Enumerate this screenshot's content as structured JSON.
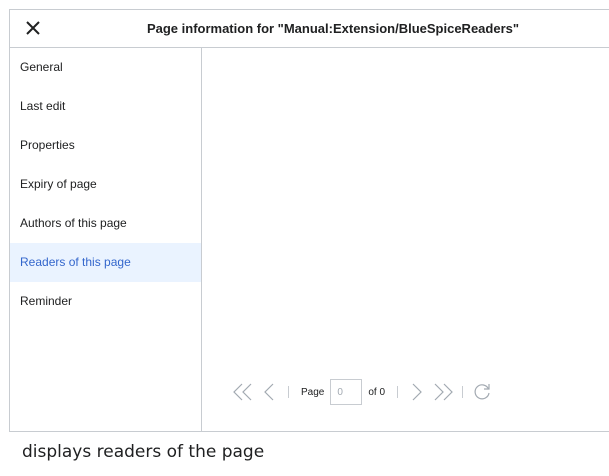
{
  "dialog": {
    "title": "Page information for \"Manual:Extension/BlueSpiceReaders\"",
    "close_icon": "close-icon"
  },
  "sidebar": {
    "items": [
      {
        "label": "General",
        "active": false
      },
      {
        "label": "Last edit",
        "active": false
      },
      {
        "label": "Properties",
        "active": false
      },
      {
        "label": "Expiry of page",
        "active": false
      },
      {
        "label": "Authors of this page",
        "active": false
      },
      {
        "label": "Readers of this page",
        "active": true
      },
      {
        "label": "Reminder",
        "active": false
      }
    ]
  },
  "pager": {
    "page_label": "Page",
    "page_value": "0",
    "of_label": "of 0",
    "icons": [
      "first-page-icon",
      "prev-page-icon",
      "next-page-icon",
      "last-page-icon",
      "refresh-icon"
    ]
  },
  "caption": "displays readers of the page",
  "colors": {
    "border": "#c8ccd1",
    "active_bg": "#eaf3ff",
    "active_text": "#3366cc",
    "text": "#202122",
    "disabled": "#a2a9b1"
  }
}
